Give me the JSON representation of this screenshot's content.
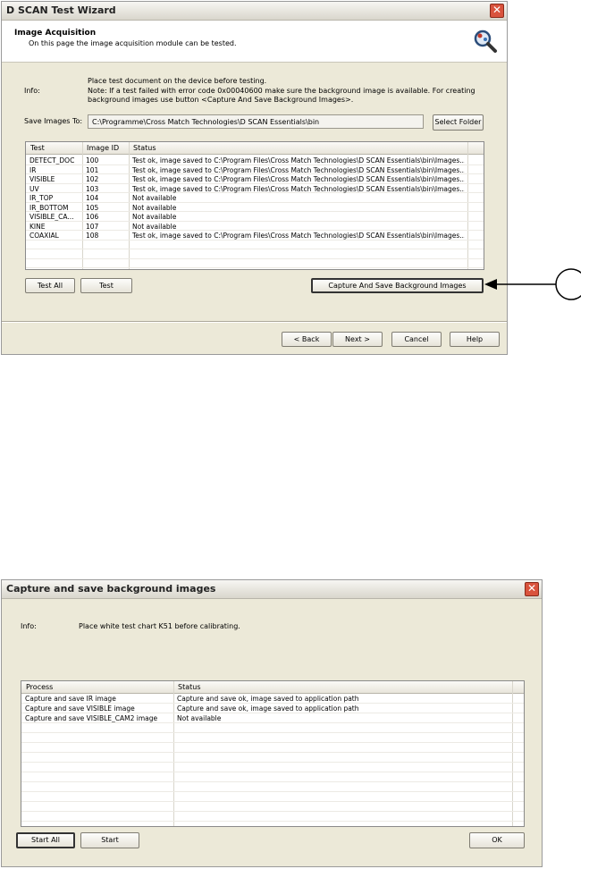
{
  "wizard": {
    "title": "D SCAN Test Wizard",
    "header_title": "Image Acquisition",
    "header_subtitle": "On this page the image acquisition module can be tested.",
    "info_label": "Info:",
    "info_line1": "Place test document on the device before testing.",
    "info_line2": "Note: If a test failed with error code 0x00040600 make sure the background image is available. For creating",
    "info_line3": "background images use button <Capture And Save Background Images>.",
    "save_label": "Save Images To:",
    "save_path": "C:\\Programme\\Cross Match Technologies\\D SCAN Essentials\\bin",
    "select_folder": "Select Folder",
    "columns": [
      "Test",
      "Image ID",
      "Status"
    ],
    "rows": [
      {
        "test": "DETECT_DOC",
        "id": "100",
        "status": "Test ok, image saved to C:\\Program Files\\Cross Match Technologies\\D SCAN Essentials\\bin\\Images..."
      },
      {
        "test": "IR",
        "id": "101",
        "status": "Test ok, image saved to C:\\Program Files\\Cross Match Technologies\\D SCAN Essentials\\bin\\Images..."
      },
      {
        "test": "VISIBLE",
        "id": "102",
        "status": "Test ok, image saved to C:\\Program Files\\Cross Match Technologies\\D SCAN Essentials\\bin\\Images..."
      },
      {
        "test": "UV",
        "id": "103",
        "status": "Test ok, image saved to C:\\Program Files\\Cross Match Technologies\\D SCAN Essentials\\bin\\Images..."
      },
      {
        "test": "IR_TOP",
        "id": "104",
        "status": "Not available"
      },
      {
        "test": "IR_BOTTOM",
        "id": "105",
        "status": "Not available"
      },
      {
        "test": "VISIBLE_CA...",
        "id": "106",
        "status": "Not available"
      },
      {
        "test": "KINE",
        "id": "107",
        "status": "Not available"
      },
      {
        "test": "COAXIAL",
        "id": "108",
        "status": "Test ok, image saved to C:\\Program Files\\Cross Match Technologies\\D SCAN Essentials\\bin\\Images..."
      }
    ],
    "test_all": "Test All",
    "test": "Test",
    "capture_button": "Capture And Save Background Images",
    "back": "< Back",
    "next": "Next >",
    "cancel": "Cancel",
    "help": "Help"
  },
  "capture": {
    "title": "Capture and save background images",
    "info_label": "Info:",
    "info_text": "Place white test chart K51 before calibrating.",
    "columns": [
      "Process",
      "Status"
    ],
    "rows": [
      {
        "process": "Capture and save IR image",
        "status": "Capture and save ok, image saved to application path"
      },
      {
        "process": "Capture and save VISIBLE image",
        "status": "Capture and save ok, image saved to application path"
      },
      {
        "process": "Capture and save VISIBLE_CAM2 image",
        "status": "Not available"
      }
    ],
    "start_all": "Start All",
    "start": "Start",
    "ok": "OK"
  },
  "colors": {
    "window_bg": "#ece9d8",
    "close_red": "#d9533d"
  },
  "icons": [
    "magnifier-icon",
    "close-icon",
    "callout-circle"
  ]
}
